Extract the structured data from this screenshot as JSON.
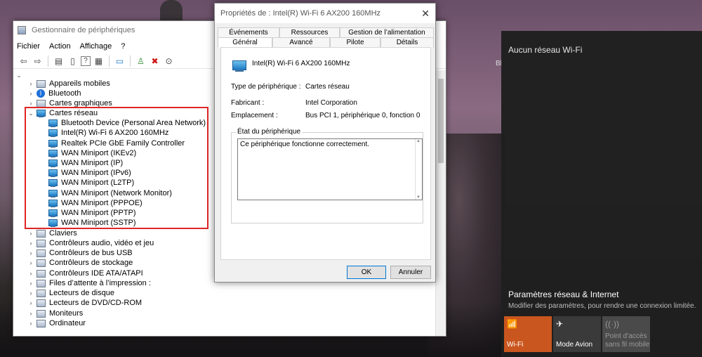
{
  "device_manager": {
    "title": "Gestionnaire de périphériques",
    "menu": [
      "Fichier",
      "Action",
      "Affichage",
      "?"
    ],
    "tree": {
      "categories_before": [
        {
          "label": "Appareils mobiles",
          "icon": "device-icon"
        },
        {
          "label": "Bluetooth",
          "icon": "bluetooth-icon"
        },
        {
          "label": "Cartes graphiques",
          "icon": "display-adapter-icon"
        }
      ],
      "expanded_category": "Cartes réseau",
      "network_adapters": [
        "Bluetooth Device (Personal Area Network)",
        "Intel(R) Wi-Fi 6 AX200 160MHz",
        "Realtek PCIe GbE Family Controller",
        "WAN Miniport (IKEv2)",
        "WAN Miniport (IP)",
        "WAN Miniport (IPv6)",
        "WAN Miniport (L2TP)",
        "WAN Miniport (Network Monitor)",
        "WAN Miniport (PPPOE)",
        "WAN Miniport (PPTP)",
        "WAN Miniport (SSTP)"
      ],
      "categories_after": [
        "Claviers",
        "Contrôleurs audio, vidéo et jeu",
        "Contrôleurs de bus USB",
        "Contrôleurs de stockage",
        "Contrôleurs IDE ATA/ATAPI",
        "Files d’attente à l’impression :",
        "Lecteurs de disque",
        "Lecteurs de DVD/CD-ROM",
        "Moniteurs",
        "Ordinateur"
      ]
    }
  },
  "properties": {
    "title": "Propriétés de : Intel(R) Wi-Fi 6 AX200 160MHz",
    "tabs_row1": [
      "Événements",
      "Ressources",
      "Gestion de l’alimentation"
    ],
    "tabs_row2": [
      "Général",
      "Avancé",
      "Pilote",
      "Détails"
    ],
    "active_tab": "Général",
    "device_name": "Intel(R) Wi-Fi 6 AX200 160MHz",
    "fields": [
      {
        "label": "Type de périphérique :",
        "value": "Cartes réseau"
      },
      {
        "label": "Fabricant :",
        "value": "Intel Corporation"
      },
      {
        "label": "Emplacement :",
        "value": "Bus PCI 1, périphérique 0, fonction 0"
      }
    ],
    "status_group": "État du périphérique",
    "status_text": "Ce périphérique fonctionne correctement.",
    "ok_label": "OK",
    "cancel_label": "Annuler"
  },
  "flyout": {
    "header": "Aucun réseau Wi-Fi",
    "partial_text": "Bl",
    "settings_title": "Paramètres réseau & Internet",
    "settings_sub": "Modifier des paramètres, pour rendre une connexion limitée.",
    "tiles": [
      {
        "label": "Wi-Fi",
        "icon": "wifi-icon",
        "color": "#c9561e"
      },
      {
        "label": "Mode Avion",
        "icon": "airplane-icon",
        "color": "#3a3a3a"
      },
      {
        "label": "Point d’accès sans fil mobile",
        "icon": "hotspot-icon",
        "color": "#4a4a4a"
      }
    ]
  }
}
